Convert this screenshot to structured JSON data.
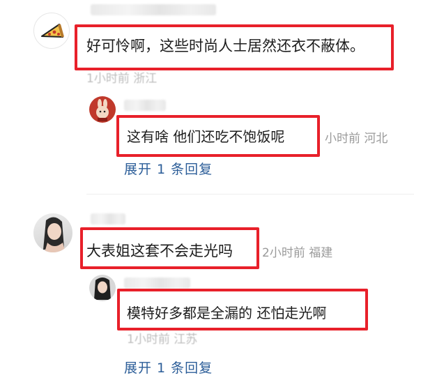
{
  "comments": [
    {
      "text": "好可怜啊，这些时尚人士居然还衣不蔽体。",
      "meta": "1小时前 浙江",
      "avatar_icon": "pizza-icon",
      "reply": {
        "text": "这有啥 他们还吃不饱饭呢",
        "meta": "小时前 河北",
        "avatar_icon": "rabbit-avatar"
      },
      "expand_label": "展开 1 条回复"
    },
    {
      "text": "大表姐这套不会走光吗",
      "meta": "2小时前 福建",
      "avatar_icon": "woman-avatar",
      "reply": {
        "text": "模特好多都是全漏的 还怕走光啊",
        "meta": "1小时前 江苏",
        "avatar_icon": "woman-avatar"
      },
      "expand_label": "展开 1 条回复"
    }
  ],
  "colors": {
    "highlight": "#e8202a",
    "link": "#2b5d98",
    "meta": "#9a9a9a"
  }
}
